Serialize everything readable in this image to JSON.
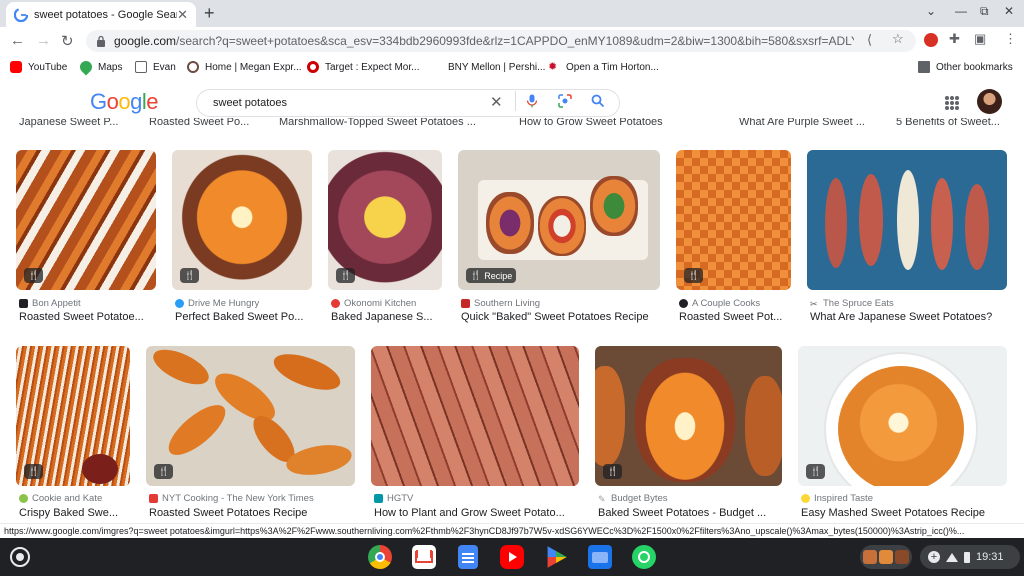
{
  "browser": {
    "tab_title": "sweet potatoes - Google Search",
    "new_tab": "+",
    "url_prefix": "google.com",
    "url_rest": "/search?q=sweet+potatoes&sca_esv=334bdb2960993fde&rlz=1CAPPDO_enMY1089&udm=2&biw=1300&bih=580&sxsrf=ADLYWIlyjSZPYR..."
  },
  "bookmarks": [
    {
      "label": "YouTube",
      "color": "#ff0000"
    },
    {
      "label": "Maps",
      "color": "#34a853"
    },
    {
      "label": "Evan",
      "color": "#202124"
    },
    {
      "label": "Home | Megan Expr...",
      "color": "#6d4c41"
    },
    {
      "label": "Target : Expect Mor...",
      "color": "#cc0000"
    },
    {
      "label": "BNY Mellon | Pershi...",
      "color": "#ffffff"
    },
    {
      "label": "Open a Tim Horton...",
      "color": "#c8102e"
    }
  ],
  "other_bookmarks": "Other bookmarks",
  "google": {
    "logo": [
      "G",
      "o",
      "o",
      "g",
      "l",
      "e"
    ],
    "logo_colors": [
      "#4285f4",
      "#ea4335",
      "#fbbc05",
      "#4285f4",
      "#34a853",
      "#ea4335"
    ],
    "query": "sweet potatoes"
  },
  "cut_row": [
    "Japanese Sweet P...",
    "Roasted Sweet Po...",
    "Marshmallow-Topped Sweet Potatoes ...",
    "How to Grow Sweet Potatoes",
    "What Are Purple Sweet ...",
    "5 Benefits of Sweet..."
  ],
  "results_row1": [
    {
      "source": "Bon Appetit",
      "title": "Roasted Sweet Potatoe...",
      "badge": "",
      "src_color": "#202124"
    },
    {
      "source": "Drive Me Hungry",
      "title": "Perfect Baked Sweet Po...",
      "badge": "",
      "src_color": "#2a9df4"
    },
    {
      "source": "Okonomi Kitchen",
      "title": "Baked Japanese S...",
      "badge": "",
      "src_color": "#e53935"
    },
    {
      "source": "Southern Living",
      "title": "Quick \"Baked\" Sweet Potatoes Recipe",
      "badge": "Recipe",
      "src_color": "#c62828"
    },
    {
      "source": "A Couple Cooks",
      "title": "Roasted Sweet Pot...",
      "badge": "",
      "src_color": "#202124"
    },
    {
      "source": "The Spruce Eats",
      "title": "What Are Japanese Sweet Potatoes?",
      "badge": "",
      "src_color": "#5f6368"
    }
  ],
  "results_row2": [
    {
      "source": "Cookie and Kate",
      "title": "Crispy Baked Swe...",
      "badge": "",
      "src_color": "#8bc34a"
    },
    {
      "source": "NYT Cooking - The New York Times",
      "title": "Roasted Sweet Potatoes Recipe",
      "badge": "",
      "src_color": "#e53935"
    },
    {
      "source": "HGTV",
      "title": "How to Plant and Grow Sweet Potato...",
      "badge": "",
      "src_color": "#0097a7"
    },
    {
      "source": "Budget Bytes",
      "title": "Baked Sweet Potatoes - Budget ...",
      "badge": "",
      "src_color": "#9e9e9e"
    },
    {
      "source": "Inspired Taste",
      "title": "Easy Mashed Sweet Potatoes Recipe",
      "badge": "",
      "src_color": "#fdd835"
    }
  ],
  "status_url": "https://www.google.com/imgres?q=sweet potatoes&imgurl=https%3A%2F%2Fwww.southernliving.com%2Fthmb%2F3hynCD8Jf97b7W5v-xdSG6YWECc%3D%2F1500x0%2Ffilters%3Ano_upscale()%3Amax_bytes(150000)%3Astrip_icc()%...",
  "shelf": {
    "time": "19:31",
    "apps": [
      "Chrome",
      "Gmail",
      "Docs",
      "YouTube",
      "Play Store",
      "Files",
      "WhatsApp"
    ],
    "app_colors": [
      "#4285f4",
      "#ea4335",
      "#4285f4",
      "#ff0000",
      "#34a853",
      "#1a73e8",
      "#25d366"
    ]
  }
}
